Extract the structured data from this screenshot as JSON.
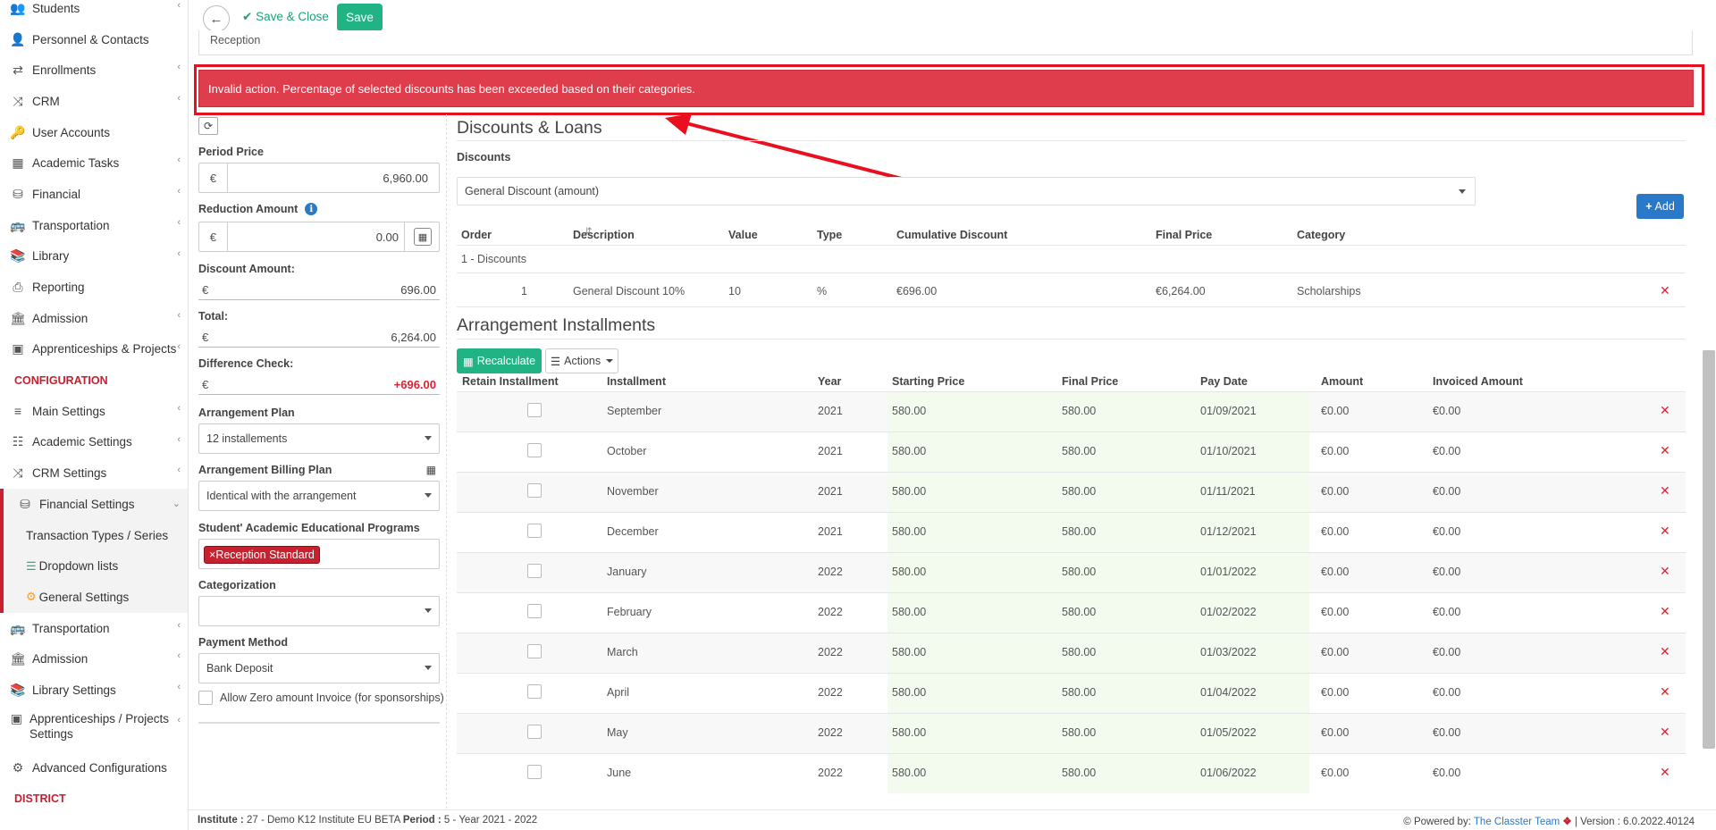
{
  "sidebar": {
    "items": [
      {
        "label": "Students",
        "icon": "users-icon",
        "chevron": true
      },
      {
        "label": "Personnel & Contacts",
        "icon": "user-icon",
        "chevron": false
      },
      {
        "label": "Enrollments",
        "icon": "exchange-icon",
        "chevron": true
      },
      {
        "label": "CRM",
        "icon": "shuffle-icon",
        "chevron": true
      },
      {
        "label": "User Accounts",
        "icon": "key-icon",
        "chevron": false
      },
      {
        "label": "Academic Tasks",
        "icon": "grid-icon",
        "chevron": true
      },
      {
        "label": "Financial",
        "icon": "database-icon",
        "chevron": true
      },
      {
        "label": "Transportation",
        "icon": "bus-icon",
        "chevron": true
      },
      {
        "label": "Library",
        "icon": "books-icon",
        "chevron": true
      },
      {
        "label": "Reporting",
        "icon": "printer-icon",
        "chevron": false
      },
      {
        "label": "Admission",
        "icon": "bank-icon",
        "chevron": true
      },
      {
        "label": "Apprenticeships & Projects",
        "icon": "cube-icon",
        "chevron": true
      }
    ],
    "section_configuration": "CONFIGURATION",
    "config_items": [
      {
        "label": "Main Settings",
        "icon": "sliders-icon",
        "chevron": true
      },
      {
        "label": "Academic Settings",
        "icon": "sitemap-icon",
        "chevron": true
      },
      {
        "label": "CRM Settings",
        "icon": "shuffle-icon",
        "chevron": true
      }
    ],
    "active_item": {
      "label": "Financial Settings",
      "icon": "database-icon"
    },
    "sub_items": [
      {
        "label": "Transaction Types / Series",
        "icon": ""
      },
      {
        "label": "Dropdown lists",
        "icon": "layers-icon"
      },
      {
        "label": "General Settings",
        "icon": "cogs-icon"
      }
    ],
    "config_items_2": [
      {
        "label": "Transportation",
        "icon": "bus-icon",
        "chevron": true
      },
      {
        "label": "Admission",
        "icon": "bank-icon",
        "chevron": true
      },
      {
        "label": "Library Settings",
        "icon": "books-icon",
        "chevron": true
      },
      {
        "label": "Apprenticeships / Projects Settings",
        "icon": "cube-icon",
        "chevron": true
      },
      {
        "label": "Advanced Configurations",
        "icon": "cogs-icon",
        "chevron": false
      }
    ],
    "section_district": "DISTRICT"
  },
  "toolbar": {
    "save_close_label": "Save & Close",
    "save_label": "Save"
  },
  "reception_value": "Reception",
  "error_message": "Invalid action. Percentage of selected discounts has been exceeded based on their categories.",
  "form": {
    "period_price_label": "Period Price",
    "period_price_currency": "€",
    "period_price_value": "6,960.00",
    "reduction_amount_label": "Reduction Amount",
    "reduction_amount_currency": "€",
    "reduction_amount_value": "0.00",
    "discount_amount_label": "Discount Amount:",
    "discount_amount_currency": "€",
    "discount_amount_value": "696.00",
    "total_label": "Total:",
    "total_currency": "€",
    "total_value": "6,264.00",
    "difference_check_label": "Difference Check:",
    "difference_check_currency": "€",
    "difference_check_value": "+696.00",
    "arrangement_plan_label": "Arrangement Plan",
    "arrangement_plan_value": "12 installements",
    "billing_plan_label": "Arrangement Billing Plan",
    "billing_plan_value": "Identical with the arrangement",
    "programs_label": "Student' Academic Educational Programs",
    "programs_tag": "Reception Standard",
    "categorization_label": "Categorization",
    "categorization_value": "",
    "payment_method_label": "Payment Method",
    "payment_method_value": "Bank Deposit",
    "zero_invoice_label": "Allow Zero amount Invoice (for sponsorships)"
  },
  "discounts": {
    "title": "Discounts & Loans",
    "label": "Discounts",
    "selected": "General Discount (amount)",
    "add_label": "Add",
    "columns": [
      "Order",
      "Description",
      "Value",
      "Type",
      "Cumulative Discount",
      "Final Price",
      "Category"
    ],
    "group_label": "1 - Discounts",
    "rows": [
      {
        "order": "1",
        "description": "General Discount 10%",
        "value": "10",
        "type": "%",
        "cumulative": "€696.00",
        "final_price": "€6,264.00",
        "category": "Scholarships"
      }
    ]
  },
  "installments": {
    "title": "Arrangement Installments",
    "recalculate_label": "Recalculate",
    "actions_label": "Actions",
    "columns": [
      "Retain Installment",
      "Installment",
      "Year",
      "Starting Price",
      "Final Price",
      "Pay Date",
      "Amount",
      "Invoiced Amount"
    ],
    "rows": [
      {
        "month": "September",
        "year": "2021",
        "start": "580.00",
        "final": "580.00",
        "date": "01/09/2021",
        "amount": "€0.00",
        "invoiced": "€0.00"
      },
      {
        "month": "October",
        "year": "2021",
        "start": "580.00",
        "final": "580.00",
        "date": "01/10/2021",
        "amount": "€0.00",
        "invoiced": "€0.00"
      },
      {
        "month": "November",
        "year": "2021",
        "start": "580.00",
        "final": "580.00",
        "date": "01/11/2021",
        "amount": "€0.00",
        "invoiced": "€0.00"
      },
      {
        "month": "December",
        "year": "2021",
        "start": "580.00",
        "final": "580.00",
        "date": "01/12/2021",
        "amount": "€0.00",
        "invoiced": "€0.00"
      },
      {
        "month": "January",
        "year": "2022",
        "start": "580.00",
        "final": "580.00",
        "date": "01/01/2022",
        "amount": "€0.00",
        "invoiced": "€0.00"
      },
      {
        "month": "February",
        "year": "2022",
        "start": "580.00",
        "final": "580.00",
        "date": "01/02/2022",
        "amount": "€0.00",
        "invoiced": "€0.00"
      },
      {
        "month": "March",
        "year": "2022",
        "start": "580.00",
        "final": "580.00",
        "date": "01/03/2022",
        "amount": "€0.00",
        "invoiced": "€0.00"
      },
      {
        "month": "April",
        "year": "2022",
        "start": "580.00",
        "final": "580.00",
        "date": "01/04/2022",
        "amount": "€0.00",
        "invoiced": "€0.00"
      },
      {
        "month": "May",
        "year": "2022",
        "start": "580.00",
        "final": "580.00",
        "date": "01/05/2022",
        "amount": "€0.00",
        "invoiced": "€0.00"
      },
      {
        "month": "June",
        "year": "2022",
        "start": "580.00",
        "final": "580.00",
        "date": "01/06/2022",
        "amount": "€0.00",
        "invoiced": "€0.00"
      }
    ]
  },
  "footer": {
    "institute_label": "Institute :",
    "institute_value": "27 - Demo K12 Institute EU BETA",
    "period_label": "Period :",
    "period_value": "5 - Year 2021 - 2022",
    "powered_by": "Powered by:",
    "team": "The Classter Team",
    "version": "| Version : 6.0.2022.40124"
  },
  "colors": {
    "brand_red": "#c8202f",
    "alert_red": "#e03d4c",
    "green": "#21b384",
    "blue": "#2a78c8"
  }
}
